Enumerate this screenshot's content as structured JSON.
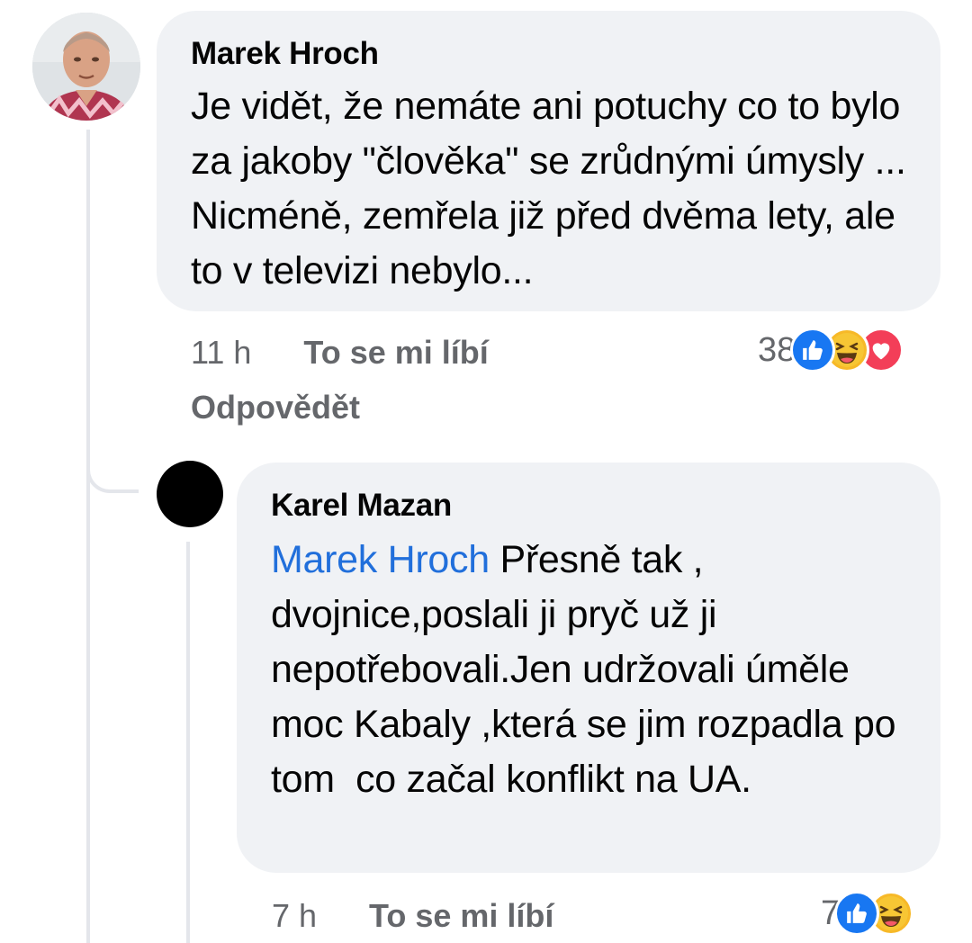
{
  "comments": [
    {
      "author": "Marek Hroch",
      "text": "Je vidět, že nemáte ani potuchy co to bylo za jakoby \"člověka\" se zrůdnými úmysly ... Nicméně, zemřela již před dvěma lety, ale to v televizi nebylo...",
      "time": "11 h",
      "like_label": "To se mi líbí",
      "reply_label": "Odpovědět",
      "reaction_count": "38",
      "reactions": [
        "like-icon",
        "haha-icon",
        "love-icon"
      ]
    },
    {
      "author": "Karel Mazan",
      "mention": "Marek Hroch",
      "text": "Přesně tak , dvojnice,poslali ji pryč už ji nepotřebovali.Jen udržovali úměle moc Kabaly ,která se jim rozpadla po tom  co začal konflikt na UA.",
      "time": "7 h",
      "like_label": "To se mi líbí",
      "reaction_count": "7",
      "reactions": [
        "like-icon",
        "haha-icon"
      ]
    }
  ],
  "colors": {
    "bubble": "#f0f2f5",
    "mention": "#216fdb",
    "meta": "#65676b",
    "like": "#1877f2",
    "haha": "#f7b928",
    "love": "#f33e58"
  }
}
